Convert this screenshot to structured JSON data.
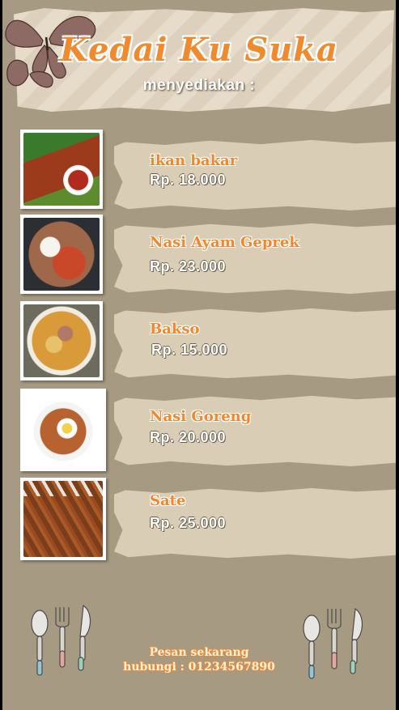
{
  "header": {
    "title": "Kedai Ku Suka",
    "subtitle": "menyediakan :"
  },
  "menu": [
    {
      "name": "ikan bakar",
      "price": "Rp. 18.000",
      "icon": "grilled-fish-photo"
    },
    {
      "name": "Nasi Ayam Geprek",
      "price": "Rp. 23.000",
      "icon": "geprek-chicken-rice-photo"
    },
    {
      "name": "Bakso",
      "price": "Rp. 15.000",
      "icon": "meatball-soup-photo"
    },
    {
      "name": "Nasi Goreng",
      "price": "Rp. 20.000",
      "icon": "fried-rice-photo"
    },
    {
      "name": "Sate",
      "price": "Rp. 25.000",
      "icon": "satay-photo"
    }
  ],
  "footer": {
    "line1": "Pesan sekarang",
    "line2": "hubungi : 01234567890"
  },
  "colors": {
    "background": "#a79a82",
    "accent": "#f08a2c",
    "paper": "#d9cdb6"
  }
}
